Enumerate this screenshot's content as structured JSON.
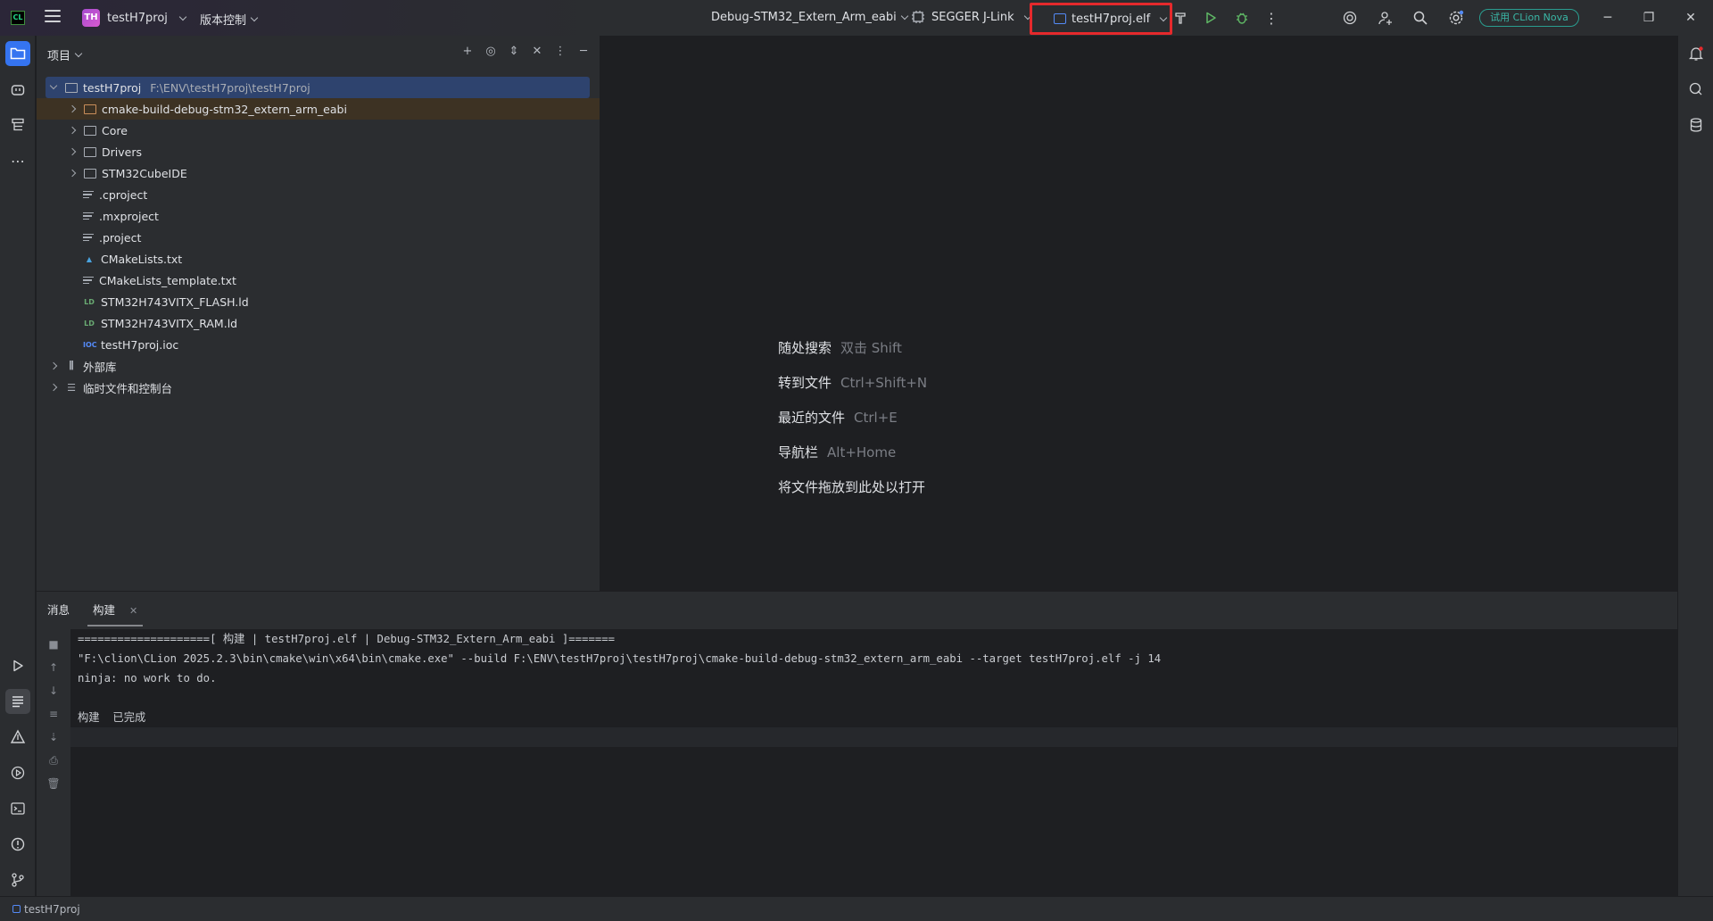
{
  "titlebar": {
    "app_logo": "CL",
    "project_badge": "TH",
    "project_name": "testH7proj",
    "vcs_label": "版本控制",
    "run_config": "Debug-STM32_Extern_Arm_eabi",
    "debugger": "SEGGER J-Link",
    "target": "testH7proj.elf",
    "nova_label": "试用 CLion Nova",
    "accent": "#3574f0",
    "highlight": "#e5292c"
  },
  "project_panel": {
    "title": "项目",
    "root": {
      "name": "testH7proj",
      "path": "F:\\ENV\\testH7proj\\testH7proj"
    },
    "items": [
      {
        "label": "cmake-build-debug-stm32_extern_arm_eabi",
        "type": "folder-excluded"
      },
      {
        "label": "Core",
        "type": "folder"
      },
      {
        "label": "Drivers",
        "type": "folder"
      },
      {
        "label": "STM32CubeIDE",
        "type": "folder"
      },
      {
        "label": ".cproject",
        "type": "file"
      },
      {
        "label": ".mxproject",
        "type": "file"
      },
      {
        "label": ".project",
        "type": "file"
      },
      {
        "label": "CMakeLists.txt",
        "type": "cmake"
      },
      {
        "label": "CMakeLists_template.txt",
        "type": "file"
      },
      {
        "label": "STM32H743VITX_FLASH.ld",
        "type": "ld"
      },
      {
        "label": "STM32H743VITX_RAM.ld",
        "type": "ld"
      },
      {
        "label": "testH7proj.ioc",
        "type": "ioc"
      }
    ],
    "external_libs": "外部库",
    "scratches": "临时文件和控制台"
  },
  "editor": {
    "hints": [
      {
        "label": "随处搜索",
        "shortcut": "双击 Shift"
      },
      {
        "label": "转到文件",
        "shortcut": "Ctrl+Shift+N"
      },
      {
        "label": "最近的文件",
        "shortcut": "Ctrl+E"
      },
      {
        "label": "导航栏",
        "shortcut": "Alt+Home"
      },
      {
        "label": "将文件拖放到此处以打开",
        "shortcut": ""
      }
    ]
  },
  "bottom_panel": {
    "tabs": [
      "消息",
      "构建"
    ],
    "console_lines": [
      "====================[ 构建 | testH7proj.elf | Debug-STM32_Extern_Arm_eabi ]=======",
      "\"F:\\clion\\CLion 2025.2.3\\bin\\cmake\\win\\x64\\bin\\cmake.exe\" --build F:\\ENV\\testH7proj\\testH7proj\\cmake-build-debug-stm32_extern_arm_eabi --target testH7proj.elf -j 14",
      "ninja: no work to do.",
      "",
      "构建  已完成"
    ]
  },
  "statusbar": {
    "project": "testH7proj"
  }
}
